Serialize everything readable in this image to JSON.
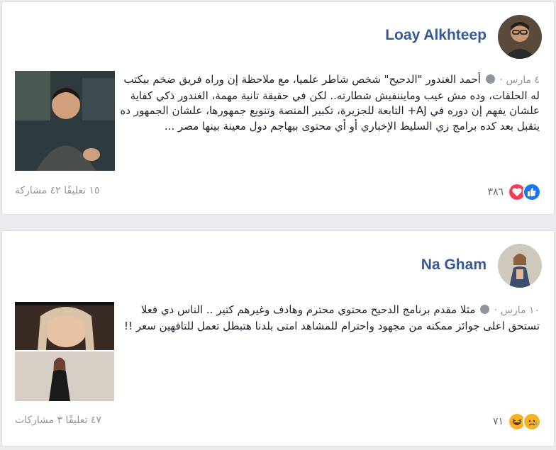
{
  "posts": [
    {
      "author": "Loay Alkhteep",
      "meta": "٤ مارس ·",
      "text": "أحمد الغندور \"الدحيح\" شخص شاطر علميا، مع ملاحظة إن وراه فريق ضخم بيكتب له الحلقات، وده مش عيب ومايننفيش شطارته.. لكن في حقيقة تانية مهمة، الغندور ذكي كفاية علشان يفهم إن دوره في AJ+ التابعة للجزيرة، تكبير المنصة وتنويع جمهورها، علشان الجمهور ده يتقبل بعد كده برامج زي السليط الإخباري أو أي محتوى بيهاجم دول معينة بينها مصر ...",
      "comments_shares": "١٥ تعليقًا ٤٢ مشاركة",
      "reaction_count": "٣٨٦"
    },
    {
      "author": "Na Gham",
      "meta": "١٠ مارس ·",
      "text": "مثلا مقدم برنامج الدحيح محتوي محترم وهادف وغيرهم كتير .. الناس دي فعلا تستحق اعلى جوائز ممكنه من مجهود واحترام للمشاهد امتى بلدنا هتبطل تعمل للتافهين سعر !!",
      "comments_shares": "٤٧ تعليقًا ٣ مشاركات",
      "reaction_count": "٧١"
    }
  ]
}
